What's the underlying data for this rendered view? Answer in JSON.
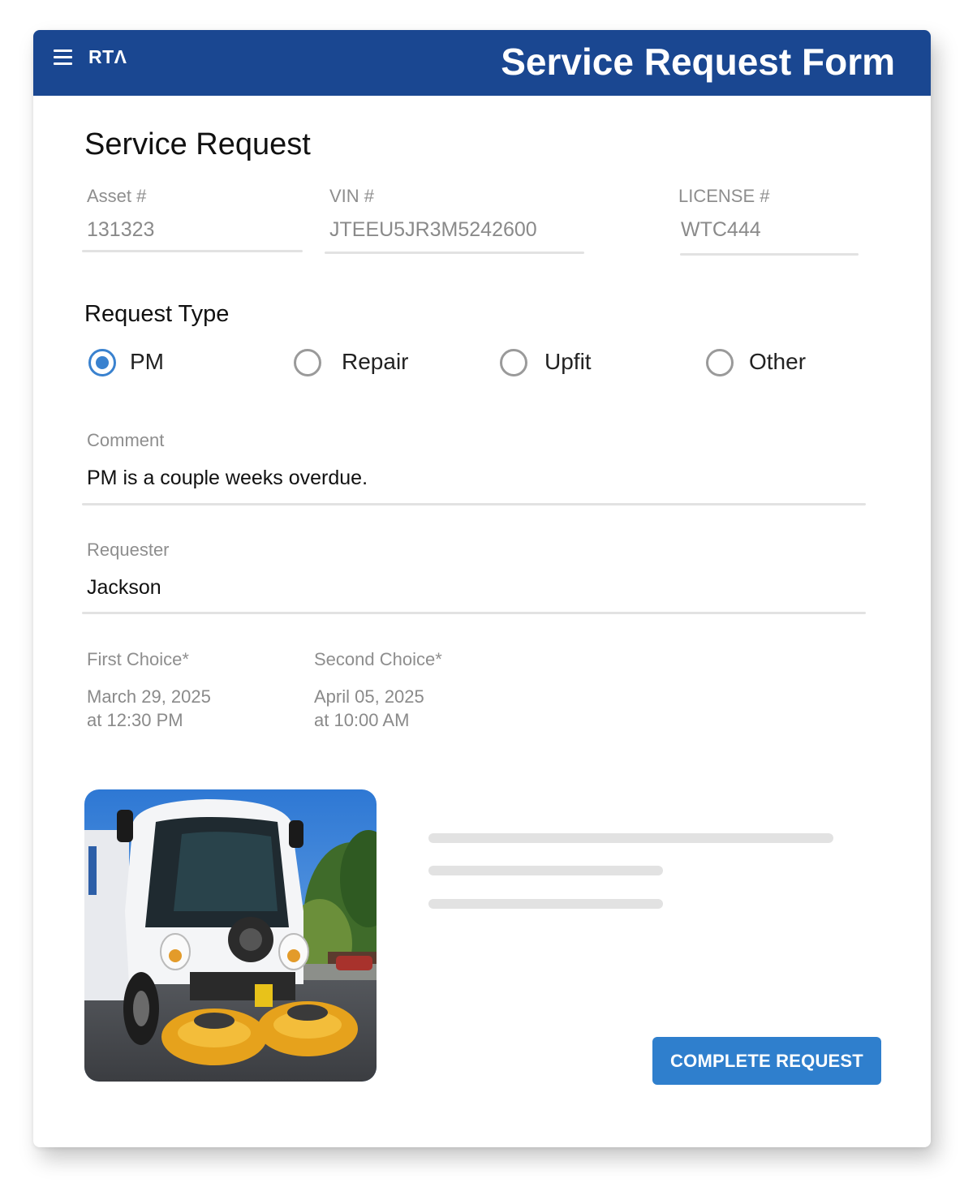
{
  "header": {
    "logo_text": "RTΛ",
    "title": "Service Request Form"
  },
  "service_request": {
    "heading": "Service Request",
    "asset": {
      "label": "Asset #",
      "value": "131323"
    },
    "vin": {
      "label": "VIN #",
      "value": "JTEEU5JR3M5242600"
    },
    "license": {
      "label": "LICENSE #",
      "value": "WTC444"
    }
  },
  "request_type": {
    "heading": "Request Type",
    "options": [
      "PM",
      "Repair",
      "Upfit",
      "Other"
    ],
    "selected": "PM"
  },
  "comment": {
    "label": "Comment",
    "value": "PM is a couple weeks overdue."
  },
  "requester": {
    "label": "Requester",
    "value": "Jackson"
  },
  "schedule": {
    "first": {
      "label": "First Choice*",
      "date": "March 29, 2025",
      "time": "at 12:30 PM"
    },
    "second": {
      "label": "Second Choice*",
      "date": "April 05, 2025",
      "time": "at 10:00 AM"
    }
  },
  "actions": {
    "complete_label": "COMPLETE REQUEST"
  },
  "colors": {
    "header_bg": "#1a4791",
    "accent": "#2f7fcd",
    "radio_selected": "#3a82cf"
  },
  "icons": {
    "menu": "hamburger-menu-icon"
  }
}
